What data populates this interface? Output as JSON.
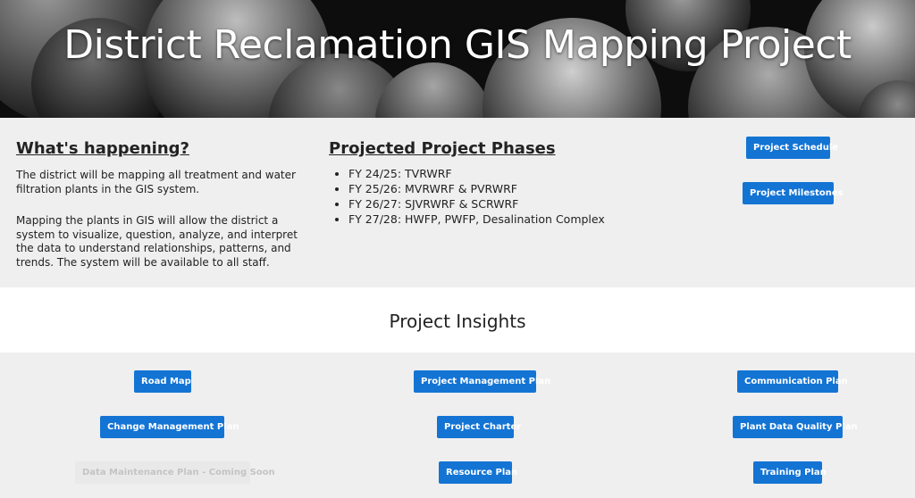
{
  "hero": {
    "title": "District Reclamation GIS Mapping Project"
  },
  "about": {
    "heading": "What's happening?",
    "paragraph1": "The district will be mapping all treatment and water filtration plants in the GIS system.",
    "paragraph2": "Mapping the plants in GIS will allow the district a system to visualize, question, analyze, and interpret the data to understand relationships, patterns, and trends. The system will be available to all staff."
  },
  "phases": {
    "heading": "Projected Project Phases",
    "items": [
      "FY 24/25: TVRWRF",
      "FY 25/26: MVRWRF & PVRWRF",
      "FY 26/27: SJVRWRF & SCRWRF",
      "FY 27/28: HWFP, PWFP, Desalination Complex"
    ]
  },
  "side_buttons": {
    "schedule": "Project Schedule",
    "milestones": "Project Milestones"
  },
  "insights": {
    "title": "Project Insights",
    "buttons": {
      "road_map": "Road Map",
      "project_management_plan": "Project Management Plan",
      "communication_plan": "Communication Plan",
      "change_management_plan": "Change Management Plan",
      "project_charter": "Project Charter",
      "plant_data_quality_plan": "Plant Data Quality Plan",
      "data_maintenance_plan": "Data Maintenance Plan - Coming Soon",
      "resource_plan": "Resource Plan",
      "training_plan": "Training Plan"
    }
  },
  "colors": {
    "button": "#1374d4",
    "hero_background": "#0d0d0d",
    "section_background": "#efefef"
  }
}
